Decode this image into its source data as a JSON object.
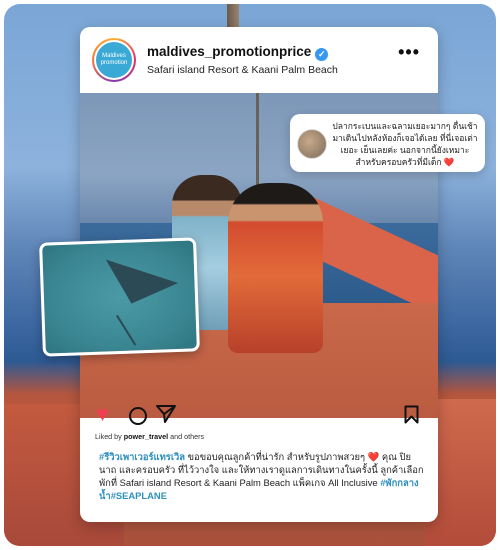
{
  "post": {
    "avatar_text_line1": "Maldives",
    "avatar_text_line2": "promotion",
    "username": "maldives_promotionprice",
    "location": "Safari island Resort & Kaani Palm Beach",
    "more_label": "•••",
    "verified_mark": "✓"
  },
  "comment": {
    "text": "ปลากระเบนและฉลามเยอะมากๆ ตื่นเช้ามาเดินไปหลังห้องก็เจอได้เลย ที่นี่เจอเต่าเยอะ เย็นเลยค่ะ นอกจากนี้ยังเหมาะสำหรับครอบครัวที่มีเด็ก ❤️"
  },
  "actions": {
    "heart_glyph": "♥",
    "liked_prefix": "Liked by ",
    "liked_user": "power_travel",
    "liked_suffix": " and others"
  },
  "caption": {
    "tag1": "#รีวิวเพาเวอร์แทรเวิล",
    "body1": " ขอขอบคุณลูกค้าที่น่ารัก สำหรับรูปภาพสวยๆ ❤️ คุณ ปิยนาถ และครอบครัว ที่ไว้วางใจ และให้ทางเราดูแลการเดินทางในครั้งนี้ ลูกค้าเลือกพักที่ Safari island Resort & Kaani Palm Beach แพ็คเกจ All Inclusive ",
    "tag2": "#พักกลางน้ำ",
    "tag3": "#SEAPLANE"
  },
  "colors": {
    "heart": "#ed3f4f",
    "hashtag": "#2f8fbf",
    "verified": "#3897f0"
  }
}
